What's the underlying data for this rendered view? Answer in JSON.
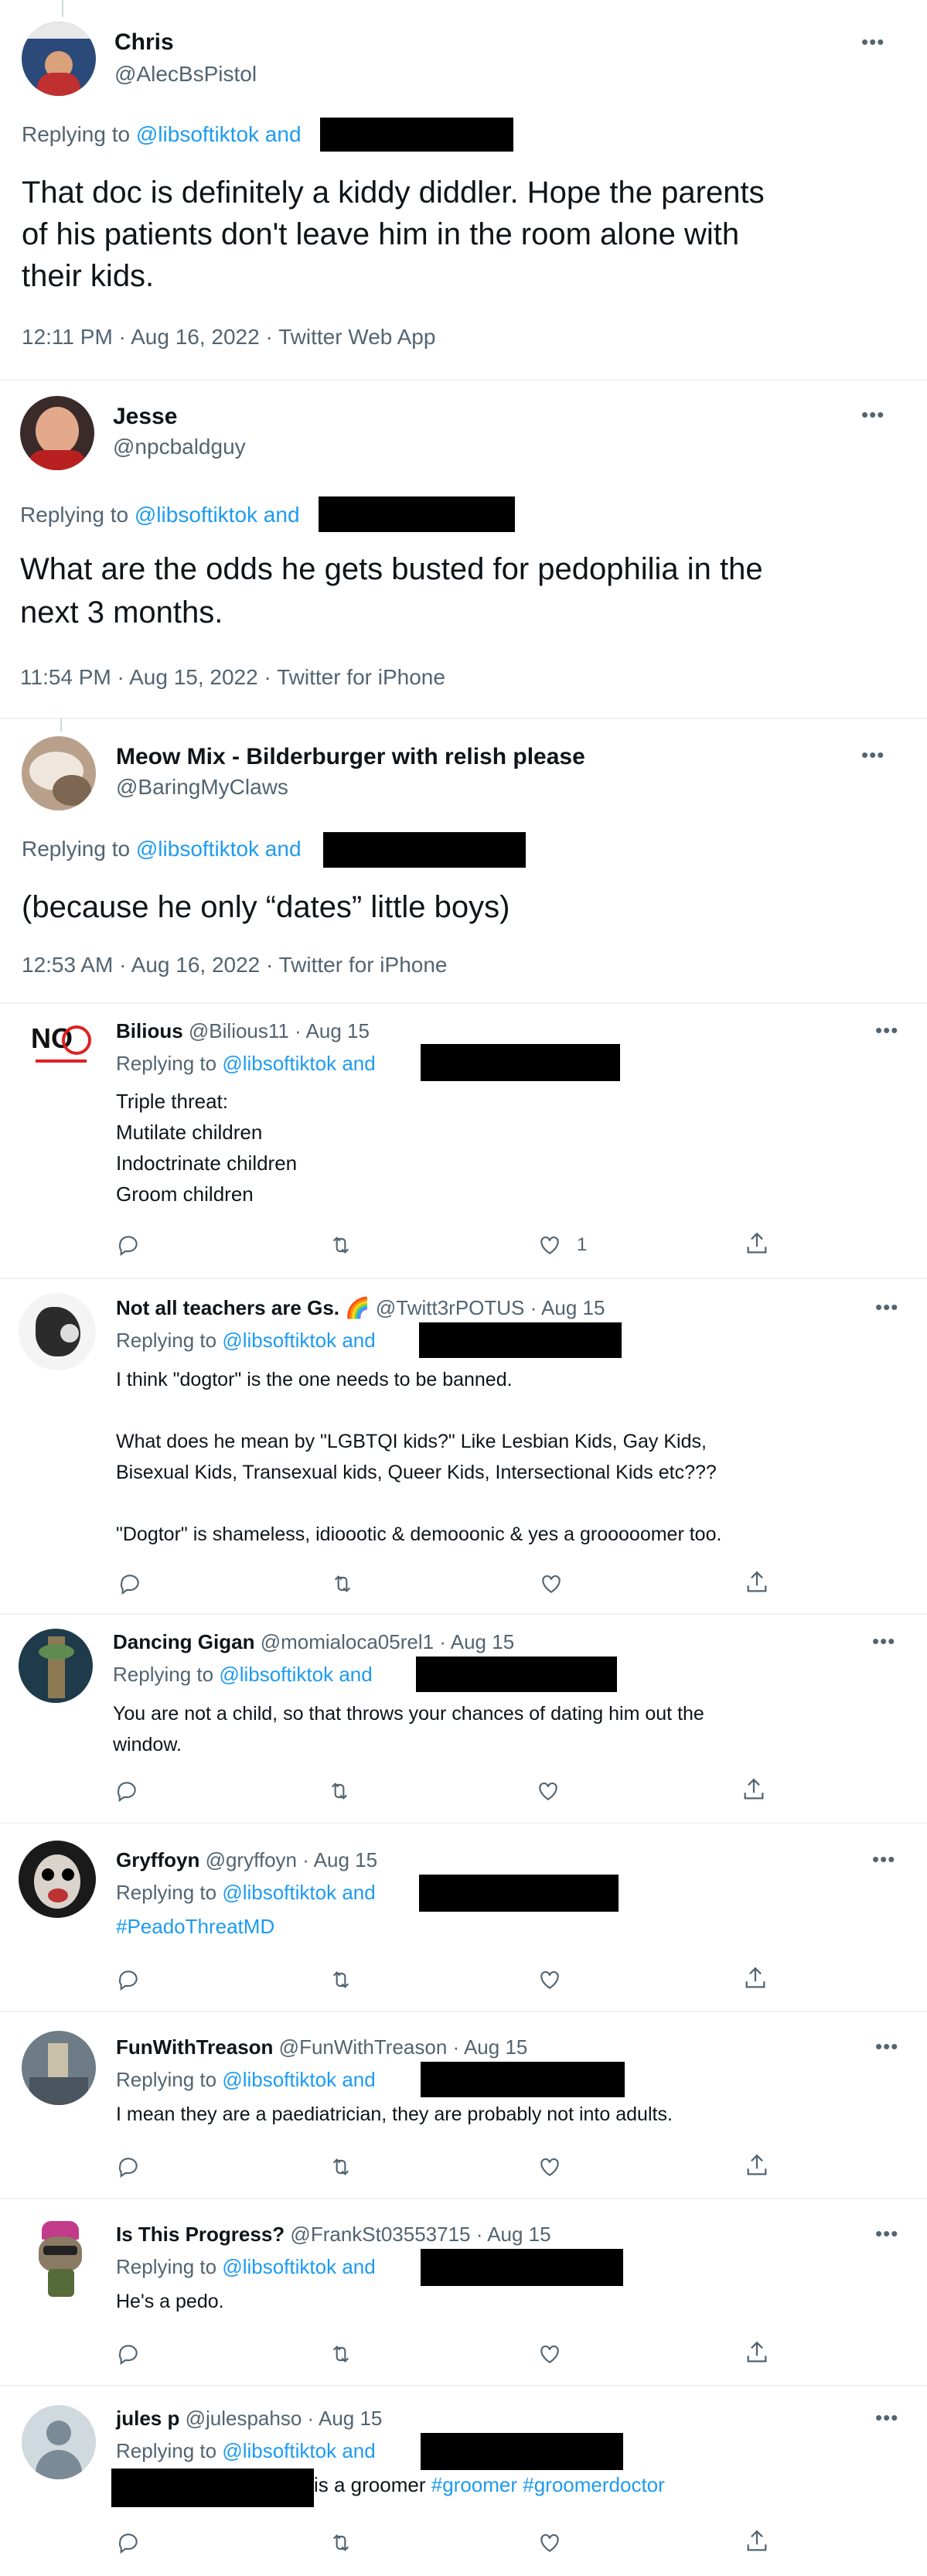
{
  "colors": {
    "link": "#1d9bf0",
    "muted": "#536471",
    "text": "#0f1419",
    "divider": "#eff3f4"
  },
  "replying_prefix": "Replying to",
  "mention": "@libsoftiktok",
  "and": "and",
  "more_icon": "more-horizontal-icon",
  "big_tweets": [
    {
      "name": "Chris",
      "handle": "@AlecBsPistol",
      "text_lines": [
        "That doc is definitely a kiddy diddler.  Hope the parents",
        "of his patients don't leave him in the room alone with",
        "their kids."
      ],
      "meta": "12:11 PM · Aug 16, 2022 · Twitter Web App"
    },
    {
      "name": "Jesse",
      "handle": "@npcbaldguy",
      "text_lines": [
        "What are the odds he gets busted for pedophilia in the",
        "next 3 months."
      ],
      "meta": "11:54 PM · Aug 15, 2022 · Twitter for iPhone"
    },
    {
      "name": "Meow Mix - Bilderburger with relish please",
      "handle": "@BaringMyClaws",
      "text_lines": [
        "(because he only “dates” little boys)"
      ],
      "meta": "12:53 AM · Aug 16, 2022 · Twitter for iPhone"
    }
  ],
  "small_tweets": [
    {
      "name": "Bilious",
      "handle": "@Bilious11 · Aug 15",
      "lines": [
        "Triple threat:",
        "Mutilate children",
        "Indoctrinate children",
        "Groom children"
      ],
      "like_count": "1",
      "avatar_text": "NO"
    },
    {
      "name": "Not all teachers are Gs. 🌈",
      "handle": "@Twitt3rPOTUS · Aug 15",
      "lines": [
        "I think \"dogtor\" is the one needs to be banned.",
        "",
        "What does he mean by \"LGBTQI kids?\" Like Lesbian Kids, Gay Kids,",
        "Bisexual Kids, Transexual kids, Queer Kids, Intersectional Kids etc???",
        "",
        "\"Dogtor\" is shameless, idioootic & demooonic & yes a grooooomer too."
      ]
    },
    {
      "name": "Dancing Gigan",
      "handle": "@momialoca05rel1 · Aug 15",
      "lines": [
        "You are not a child, so that throws your chances of dating him out the",
        "window."
      ]
    },
    {
      "name": "Gryffoyn",
      "handle": "@gryffoyn · Aug 15",
      "lines": [
        "#PeadoThreatMD"
      ]
    },
    {
      "name": "FunWithTreason",
      "handle": "@FunWithTreason · Aug 15",
      "lines": [
        "I mean they are a paediatrician, they are probably not into adults."
      ]
    },
    {
      "name": "Is This Progress?",
      "handle": "@FrankSt03553715 · Aug 15",
      "lines": [
        "He's a pedo."
      ]
    },
    {
      "name": "jules p",
      "handle": "@julespahso · Aug 15",
      "last_line_text": "is a groomer",
      "hashtags": [
        "#groomer",
        "#groomerdoctor"
      ]
    }
  ],
  "icons": [
    "reply-icon",
    "retweet-icon",
    "like-icon",
    "share-icon"
  ]
}
